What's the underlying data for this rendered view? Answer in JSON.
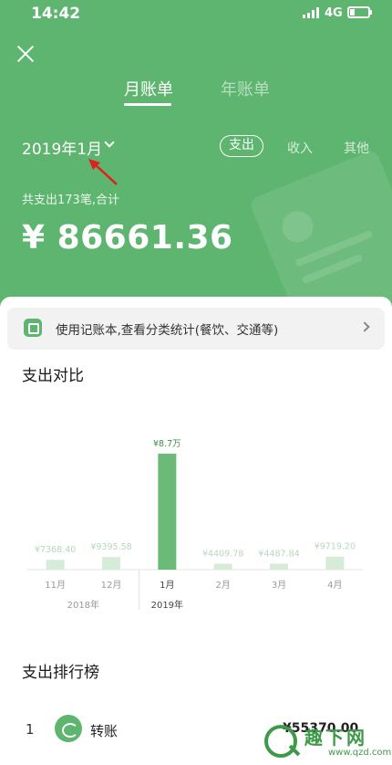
{
  "status_bar": {
    "time": "14:42",
    "network": "4G"
  },
  "tabs": {
    "month": "月账单",
    "year": "年账单"
  },
  "period": {
    "selected_month": "2019年1月"
  },
  "filters": {
    "expense": "支出",
    "income": "收入",
    "other": "其他"
  },
  "summary": {
    "text": "共支出173笔,合计",
    "total": "¥ 86661.36"
  },
  "tip": {
    "text": "使用记账本,查看分类统计(餐饮、交通等)"
  },
  "sections": {
    "compare_title": "支出对比",
    "ranking_title": "支出排行榜"
  },
  "colors": {
    "brand": "#5eb56f",
    "bar_active": "#6cba78",
    "bar_inactive": "#d6ecd9",
    "label_inactive": "#b5d9bb"
  },
  "chart_data": {
    "type": "bar",
    "categories": [
      "11月",
      "12月",
      "1月",
      "2月",
      "3月",
      "4月"
    ],
    "values": [
      7368.4,
      9395.58,
      86661.36,
      4409.78,
      4487.84,
      9719.2
    ],
    "value_labels": [
      "¥7368.40",
      "¥9395.58",
      "¥8.7万",
      "¥4409.78",
      "¥4487.84",
      "¥9719.20"
    ],
    "selected": "1月",
    "year_labels": [
      "2018年",
      "2019年"
    ],
    "ylim": [
      0,
      90000
    ],
    "grid": false
  },
  "ranking": [
    {
      "rank": "1",
      "icon": "transfer-icon",
      "name": "转账",
      "amount": "¥55370.00"
    }
  ],
  "watermark": {
    "text": "趣下网",
    "url": "www.qzd.com"
  }
}
